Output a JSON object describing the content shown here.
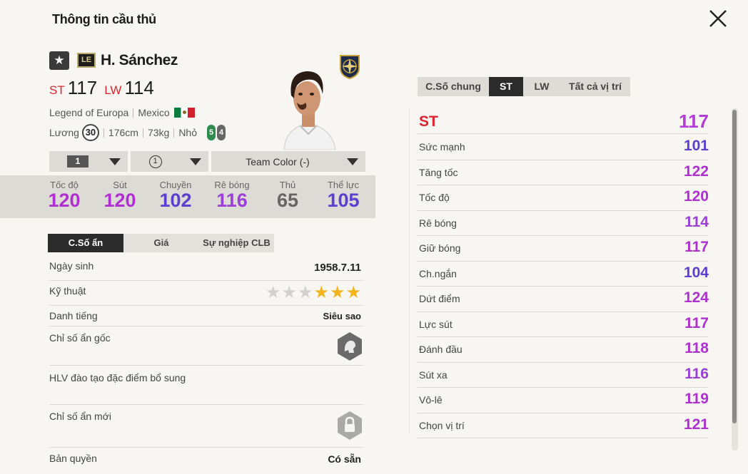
{
  "header": {
    "title": "Thông tin cầu thủ"
  },
  "player": {
    "star": "★",
    "season_badge": "LE",
    "name": "H. Sánchez",
    "positions": [
      {
        "pos": "ST",
        "ovr": "117"
      },
      {
        "pos": "LW",
        "ovr": "114"
      }
    ],
    "season": "Legend of Europa",
    "nation": "Mexico",
    "wage_label": "Lương",
    "wage": "30",
    "height": "176cm",
    "weight": "73kg",
    "body": "Nhỏ",
    "weak_foot": "5",
    "strong_foot": "4"
  },
  "selectors": {
    "level": "1",
    "enhance": "1",
    "team_color": "Team Color (-)"
  },
  "summary": [
    {
      "label": "Tốc độ",
      "value": "120",
      "color": "#b02fd0"
    },
    {
      "label": "Sút",
      "value": "120",
      "color": "#b02fd0"
    },
    {
      "label": "Chuyền",
      "value": "102",
      "color": "#5a3fd1"
    },
    {
      "label": "Rê bóng",
      "value": "116",
      "color": "#9b3fd8"
    },
    {
      "label": "Thủ",
      "value": "65",
      "color": "#666666"
    },
    {
      "label": "Thể lực",
      "value": "105",
      "color": "#5a3fd1"
    }
  ],
  "left_tabs": [
    "C.Số ẩn",
    "Giá",
    "Sự nghiệp CLB"
  ],
  "info": {
    "dob_label": "Ngày sinh",
    "dob": "1958.7.11",
    "skill_label": "Kỹ thuật",
    "skill_stars": 3,
    "fame_label": "Danh tiếng",
    "fame": "Siêu sao",
    "trait_label": "Chỉ số ẩn gốc",
    "coach_label": "HLV đào tạo đặc điểm bổ sung",
    "new_trait_label": "Chỉ số ẩn mới",
    "license_label": "Bản quyền",
    "license": "Có sẵn"
  },
  "right_tabs": [
    "C.Số chung",
    "ST",
    "LW",
    "Tất cả vị trí"
  ],
  "position_rating": {
    "label": "ST",
    "value": "117"
  },
  "attributes": [
    {
      "name": "Sức mạnh",
      "value": "101",
      "color": "#5a3fd1"
    },
    {
      "name": "Tăng tốc",
      "value": "122",
      "color": "#b02fd0"
    },
    {
      "name": "Tốc độ",
      "value": "120",
      "color": "#b02fd0"
    },
    {
      "name": "Rê bóng",
      "value": "114",
      "color": "#9b3fd8"
    },
    {
      "name": "Giữ bóng",
      "value": "117",
      "color": "#b02fd0"
    },
    {
      "name": "Ch.ngắn",
      "value": "104",
      "color": "#5a3fd1"
    },
    {
      "name": "Dứt điểm",
      "value": "124",
      "color": "#b02fd0"
    },
    {
      "name": "Lực sút",
      "value": "117",
      "color": "#b02fd0"
    },
    {
      "name": "Đánh đầu",
      "value": "118",
      "color": "#b02fd0"
    },
    {
      "name": "Sút xa",
      "value": "116",
      "color": "#9b3fd8"
    },
    {
      "name": "Vô-lê",
      "value": "119",
      "color": "#b02fd0"
    },
    {
      "name": "Chọn vị trí",
      "value": "121",
      "color": "#b02fd0"
    }
  ]
}
